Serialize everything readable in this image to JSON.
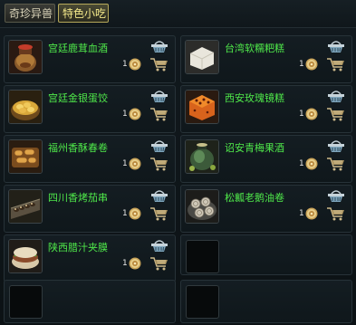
{
  "tabs": [
    {
      "label": "奇珍异兽",
      "active": false
    },
    {
      "label": "特色小吃",
      "active": true
    }
  ],
  "items": [
    {
      "name": "宫廷鹿茸血酒",
      "qty": "1",
      "icon": "wine-pot-icon"
    },
    {
      "name": "台湾软糯粑糕",
      "qty": "1",
      "icon": "rice-cake-icon"
    },
    {
      "name": "宫廷金银蛋饺",
      "qty": "1",
      "icon": "dumpling-basket-icon"
    },
    {
      "name": "西安玫瑰镜糕",
      "qty": "1",
      "icon": "rose-cake-icon"
    },
    {
      "name": "福州香酥春卷",
      "qty": "1",
      "icon": "spring-roll-icon"
    },
    {
      "name": "诏安青梅果酒",
      "qty": "1",
      "icon": "plum-wine-jar-icon"
    },
    {
      "name": "四川香烤茄串",
      "qty": "1",
      "icon": "skewer-tray-icon"
    },
    {
      "name": "松瓤老鹅油卷",
      "qty": "1",
      "icon": "goose-roll-icon"
    },
    {
      "name": "陕西腊汁夹膜",
      "qty": "1",
      "icon": "roujiamo-icon"
    }
  ],
  "colors": {
    "item_name": "#4fe84a",
    "background": "#0d1317",
    "tab_active_text": "#f3e88a"
  }
}
